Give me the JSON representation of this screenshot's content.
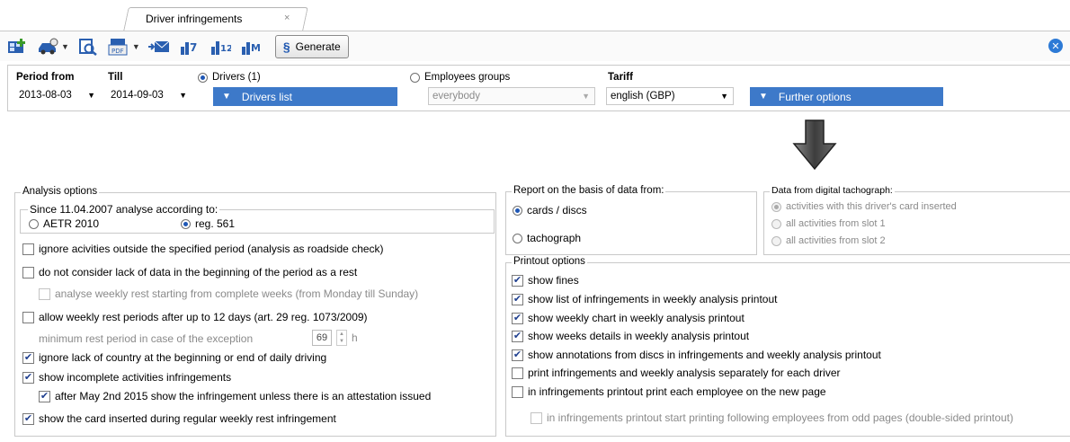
{
  "tab": {
    "title": "Driver infringements",
    "close": "×"
  },
  "toolbar": {
    "icons": [
      "new-report-icon",
      "car-filter-icon",
      "print-preview-icon",
      "pdf-export-icon",
      "email-icon",
      "chart-7-icon",
      "chart-12-icon",
      "chart-m-icon"
    ],
    "generate_label": "Generate",
    "generate_symbol": "§",
    "close_symbol": "✕"
  },
  "filters": {
    "period_from_label": "Period from",
    "period_from_value": "2013-08-03",
    "till_label": "Till",
    "till_value": "2014-09-03",
    "drivers_label": "Drivers (1)",
    "drivers_list_label": "Drivers list",
    "employees_groups_label": "Employees groups",
    "employees_groups_value": "everybody",
    "tariff_label": "Tariff",
    "tariff_value": "english (GBP)",
    "further_options_label": "Further options"
  },
  "analysis": {
    "title": "Analysis options",
    "since_title": "Since 11.04.2007 analyse according to:",
    "aetr_label": "AETR 2010",
    "reg_label": "reg. 561",
    "options": [
      {
        "label": "ignore acivities outside the specified period (analysis as roadside check)",
        "checked": false
      },
      {
        "label": "do not consider lack of data in the beginning of the period as a rest",
        "checked": false
      },
      {
        "label": "analyse weekly rest starting from complete weeks (from Monday till Sunday)",
        "checked": false,
        "disabled": true
      },
      {
        "label": "allow weekly rest periods after up to 12 days (art. 29 reg. 1073/2009)",
        "checked": false
      },
      {
        "label": "ignore lack of country at the beginning or end of daily driving",
        "checked": true
      },
      {
        "label": "show incomplete activities infringements",
        "checked": true
      },
      {
        "label": "after May 2nd 2015 show the infringement unless there is an attestation issued",
        "checked": true
      },
      {
        "label": "show the card inserted during regular weekly rest infringement",
        "checked": true
      }
    ],
    "min_rest_label": "minimum rest period in case of the exception",
    "min_rest_value": "69",
    "min_rest_unit": "h"
  },
  "report_basis": {
    "title": "Report on the basis of data from:",
    "cards_label": "cards / discs",
    "tachograph_label": "tachograph"
  },
  "digital": {
    "title": "Data from digital tachograph:",
    "options": [
      "activities with this driver's card inserted",
      "all activities from slot 1",
      "all activities from slot 2"
    ]
  },
  "printout": {
    "title": "Printout options",
    "options": [
      {
        "label": "show fines",
        "checked": true
      },
      {
        "label": "show list of infringements in weekly analysis printout",
        "checked": true
      },
      {
        "label": "show weekly chart in weekly analysis printout",
        "checked": true
      },
      {
        "label": "show weeks details in weekly analysis printout",
        "checked": true
      },
      {
        "label": "show annotations from discs in infringements and weekly analysis printout",
        "checked": true
      },
      {
        "label": "print infringements and weekly analysis separately for each driver",
        "checked": false
      },
      {
        "label": "in infringements printout print each employee on the new page",
        "checked": false
      },
      {
        "label": "in infringements printout start printing following employees from odd pages (double-sided printout)",
        "checked": false,
        "disabled": true
      }
    ]
  },
  "colors": {
    "accent_blue": "#3d79c9",
    "border": "#c9c9c9",
    "arrow": "#5a5a5a"
  }
}
